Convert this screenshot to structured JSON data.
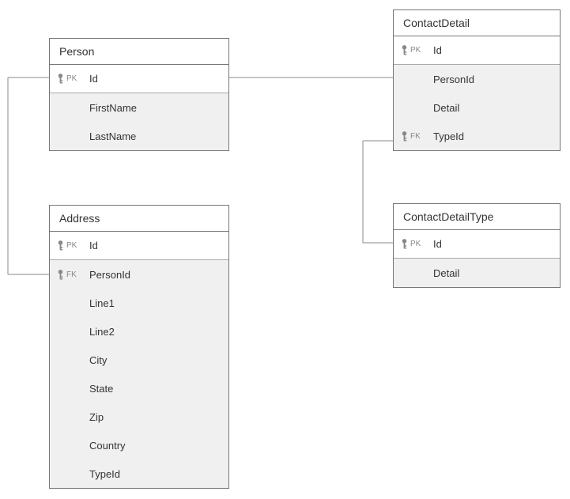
{
  "entities": {
    "person": {
      "title": "Person",
      "fields": [
        {
          "name": "Id",
          "pk": true,
          "fk": false
        },
        {
          "name": "FirstName",
          "pk": false,
          "fk": false
        },
        {
          "name": "LastName",
          "pk": false,
          "fk": false
        }
      ]
    },
    "address": {
      "title": "Address",
      "fields": [
        {
          "name": "Id",
          "pk": true,
          "fk": false
        },
        {
          "name": "PersonId",
          "pk": false,
          "fk": true
        },
        {
          "name": "Line1",
          "pk": false,
          "fk": false
        },
        {
          "name": "Line2",
          "pk": false,
          "fk": false
        },
        {
          "name": "City",
          "pk": false,
          "fk": false
        },
        {
          "name": "State",
          "pk": false,
          "fk": false
        },
        {
          "name": "Zip",
          "pk": false,
          "fk": false
        },
        {
          "name": "Country",
          "pk": false,
          "fk": false
        },
        {
          "name": "TypeId",
          "pk": false,
          "fk": false
        }
      ]
    },
    "contactDetail": {
      "title": "ContactDetail",
      "fields": [
        {
          "name": "Id",
          "pk": true,
          "fk": false
        },
        {
          "name": "PersonId",
          "pk": false,
          "fk": false
        },
        {
          "name": "Detail",
          "pk": false,
          "fk": false
        },
        {
          "name": "TypeId",
          "pk": false,
          "fk": true
        }
      ]
    },
    "contactDetailType": {
      "title": "ContactDetailType",
      "fields": [
        {
          "name": "Id",
          "pk": true,
          "fk": false
        },
        {
          "name": "Detail",
          "pk": false,
          "fk": false
        }
      ]
    }
  },
  "labels": {
    "pk": "PK",
    "fk": "FK"
  }
}
